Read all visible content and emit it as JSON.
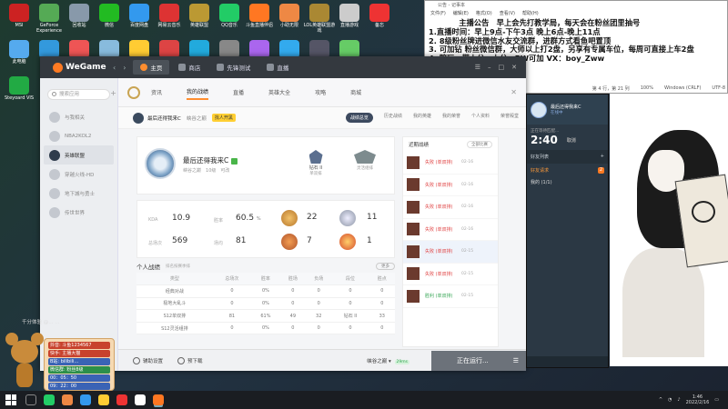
{
  "desktop": {
    "icons": [
      {
        "label": "MSI",
        "color": "#c22"
      },
      {
        "label": "GeForce Experience",
        "color": "#5a5"
      },
      {
        "label": "回收站",
        "color": "#89a"
      },
      {
        "label": "微信",
        "color": "#2b2"
      },
      {
        "label": "百度网盘",
        "color": "#39e"
      },
      {
        "label": "网易云音乐",
        "color": "#d33"
      },
      {
        "label": "英雄联盟",
        "color": "#b93"
      },
      {
        "label": "QQ音乐",
        "color": "#2c6"
      },
      {
        "label": "斗鱼直播伴侣",
        "color": "#f72"
      },
      {
        "label": "小助无限",
        "color": "#e84"
      },
      {
        "label": "LOL英雄联盟游戏",
        "color": "#a83"
      },
      {
        "label": "直播游戏",
        "color": "#ccc"
      },
      {
        "label": "备忘",
        "color": "#e33"
      },
      {
        "label": "此电脑",
        "color": "#5ae"
      },
      {
        "label": "",
        "color": "#39d"
      },
      {
        "label": "",
        "color": "#e55"
      },
      {
        "label": "",
        "color": "#8bd"
      },
      {
        "label": "",
        "color": "#fc3"
      },
      {
        "label": "",
        "color": "#d44"
      },
      {
        "label": "",
        "color": "#2ad"
      },
      {
        "label": "",
        "color": "#888"
      },
      {
        "label": "",
        "color": "#a6e"
      },
      {
        "label": "",
        "color": "#3ae"
      },
      {
        "label": "",
        "color": "#556"
      },
      {
        "label": "",
        "color": "#6c6"
      },
      {
        "label": "Steyoard VIS",
        "color": "#2a4"
      }
    ]
  },
  "notepad": {
    "title": "公告 - 记事本",
    "menu": [
      "文件(F)",
      "编辑(E)",
      "格式(O)",
      "查看(V)",
      "帮助(H)"
    ],
    "lines": [
      "　　　　主播公告　早上会先打教学局，每天会在粉丝团里抽号",
      "1.直播时间：早上9点-下午3点 晚上6点-晚上11点",
      "2. 8级粉丝牌进微信水友交流群，进群方式看鱼吧置顶",
      "3. 可加钻 粉丝微信群，大师以上打2盘，另享有专属车位，每周可直接上车2盘",
      "4. 陪玩、带上分、上分、PW可加 VX：boy_Zww"
    ],
    "status": [
      "第 4 行，第 21 列",
      "100%",
      "Windows (CRLF)",
      "UTF-8"
    ]
  },
  "wegame": {
    "logo": "WeGame",
    "tabs": [
      "主页",
      "商店",
      "先锋测试",
      "直播"
    ],
    "search_placeholder": "搜索应用",
    "side_games": [
      "与我相关",
      "NBA2KOL2",
      "英雄联盟",
      "穿越火线-HD",
      "地下城与勇士",
      "传世世界"
    ],
    "lol_tabs": [
      "资讯",
      "我的战绩",
      "直播",
      "英雄大全",
      "攻略",
      "商城"
    ],
    "account": {
      "name": "最后还得我来C",
      "server": "峡谷之巅",
      "button": "找人开黑",
      "tabs": [
        "战绩总览",
        "历史战绩",
        "我的英雄",
        "我的荣誉",
        "个人资料",
        "荣誉殿堂"
      ]
    },
    "profile": {
      "name": "最后还得我来C",
      "meta": [
        "峡谷之巅",
        "10级",
        "可改"
      ],
      "rank1": {
        "title": "钻石 II",
        "sub": "单双排"
      },
      "rank2": {
        "title": "",
        "sub": "灵活组排"
      }
    },
    "stats": {
      "kda_label": "KDA",
      "kda": "10.9",
      "winrate_label": "胜率",
      "winrate": "60.5",
      "winrate_unit": "%",
      "total_label": "总场次",
      "total": "569",
      "score_label": "场均",
      "score": "81",
      "medals": [
        "22",
        "11",
        "7",
        "1"
      ]
    },
    "record": {
      "title": "个人战绩",
      "subtitle": "排名按赛季排",
      "more": "更多",
      "headers": [
        "类型",
        "总场次",
        "胜率",
        "胜场",
        "负场",
        "段位",
        "胜点"
      ],
      "rows": [
        [
          "经典对战",
          "0",
          "0%",
          "0",
          "0",
          "0",
          "0"
        ],
        [
          "极地大乱斗",
          "0",
          "0%",
          "0",
          "0",
          "0",
          "0"
        ],
        [
          "S12单双排",
          "81",
          "61%",
          "49",
          "32",
          "钻石 II",
          "33"
        ],
        [
          "S12灵活组排",
          "0",
          "0%",
          "0",
          "0",
          "0",
          "0"
        ]
      ]
    },
    "history": {
      "title": "近期战绩",
      "filter": "全部比赛",
      "rows": [
        {
          "result": "失败 (单双排)",
          "date": "02-16",
          "win": false
        },
        {
          "result": "失败 (单双排)",
          "date": "02-16",
          "win": false
        },
        {
          "result": "失败 (单双排)",
          "date": "02-16",
          "win": false
        },
        {
          "result": "失败 (单双排)",
          "date": "02-16",
          "win": false
        },
        {
          "result": "失败 (单双排)",
          "date": "02-15",
          "win": false
        },
        {
          "result": "失败 (单双排)",
          "date": "02-15",
          "win": false
        },
        {
          "result": "胜利 (单双排)",
          "date": "02-15",
          "win": true
        }
      ]
    },
    "bottom": {
      "assist": "辅助设置",
      "preload": "预下载",
      "server": "峡谷之巅",
      "ping": "29ms",
      "launch": "正在运行..."
    }
  },
  "chat": {
    "name": "最后还得我来C",
    "status": "在线中",
    "now": "正在等待匹配...",
    "time": "2:40",
    "cancel": "取消",
    "friends": "好友列表",
    "group": "好友请求",
    "group_count": "2",
    "sub": "我的 (1/1)"
  },
  "overlay": {
    "top": "千分体验  @...  ...",
    "lines": [
      "抖音: 斗鱼1234567",
      "快手: 主播大猫",
      "B站: bilibili…",
      "微信群: 粉丝8级",
      "00：05：50",
      "09：22：00"
    ]
  },
  "taskbar": {
    "icons": [
      "#2c6",
      "#e84",
      "#39e",
      "#fc3",
      "#e33",
      "#fff",
      "#f72"
    ],
    "clock_time": "1:46",
    "clock_date": "2022/2/16"
  }
}
